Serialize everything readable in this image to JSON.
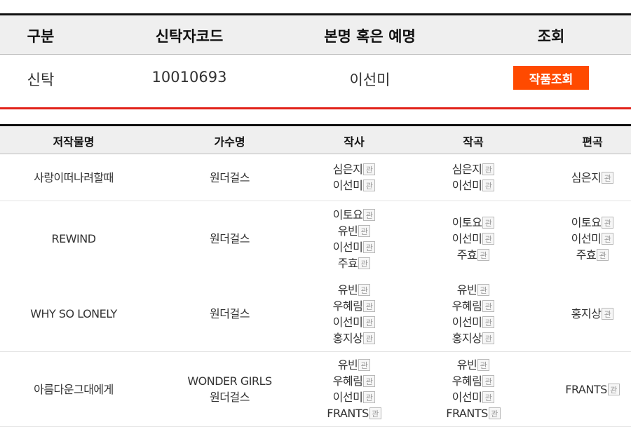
{
  "info": {
    "headers": [
      "구분",
      "신탁자코드",
      "본명 혹은 예명",
      "조회"
    ],
    "category": "신탁",
    "code": "10010693",
    "name": "이선미",
    "button_label": "작품조회"
  },
  "works": {
    "headers": [
      "저작물명",
      "가수명",
      "작사",
      "작곡",
      "편곡"
    ],
    "icon_label": "관",
    "rows": [
      {
        "title": "사랑이떠나려할때",
        "singers": [
          "원더걸스"
        ],
        "lyricists": [
          "심은지",
          "이선미"
        ],
        "composers": [
          "심은지",
          "이선미"
        ],
        "arrangers": [
          "심은지"
        ]
      },
      {
        "title": "REWIND",
        "singers": [
          "원더걸스"
        ],
        "lyricists": [
          "이토요",
          "유빈",
          "이선미",
          "주효"
        ],
        "composers": [
          "이토요",
          "이선미",
          "주효"
        ],
        "arrangers": [
          "이토요",
          "이선미",
          "주효"
        ]
      },
      {
        "title": "WHY SO LONELY",
        "singers": [
          "원더걸스"
        ],
        "lyricists": [
          "유빈",
          "우혜림",
          "이선미",
          "홍지상"
        ],
        "composers": [
          "유빈",
          "우혜림",
          "이선미",
          "홍지상"
        ],
        "arrangers": [
          "홍지상"
        ]
      },
      {
        "title": "아름다운그대에게",
        "singers": [
          "WONDER GIRLS",
          "원더걸스"
        ],
        "lyricists": [
          "유빈",
          "우혜림",
          "이선미",
          "FRANTS"
        ],
        "composers": [
          "유빈",
          "우혜림",
          "이선미",
          "FRANTS"
        ],
        "arrangers": [
          "FRANTS"
        ]
      }
    ]
  }
}
